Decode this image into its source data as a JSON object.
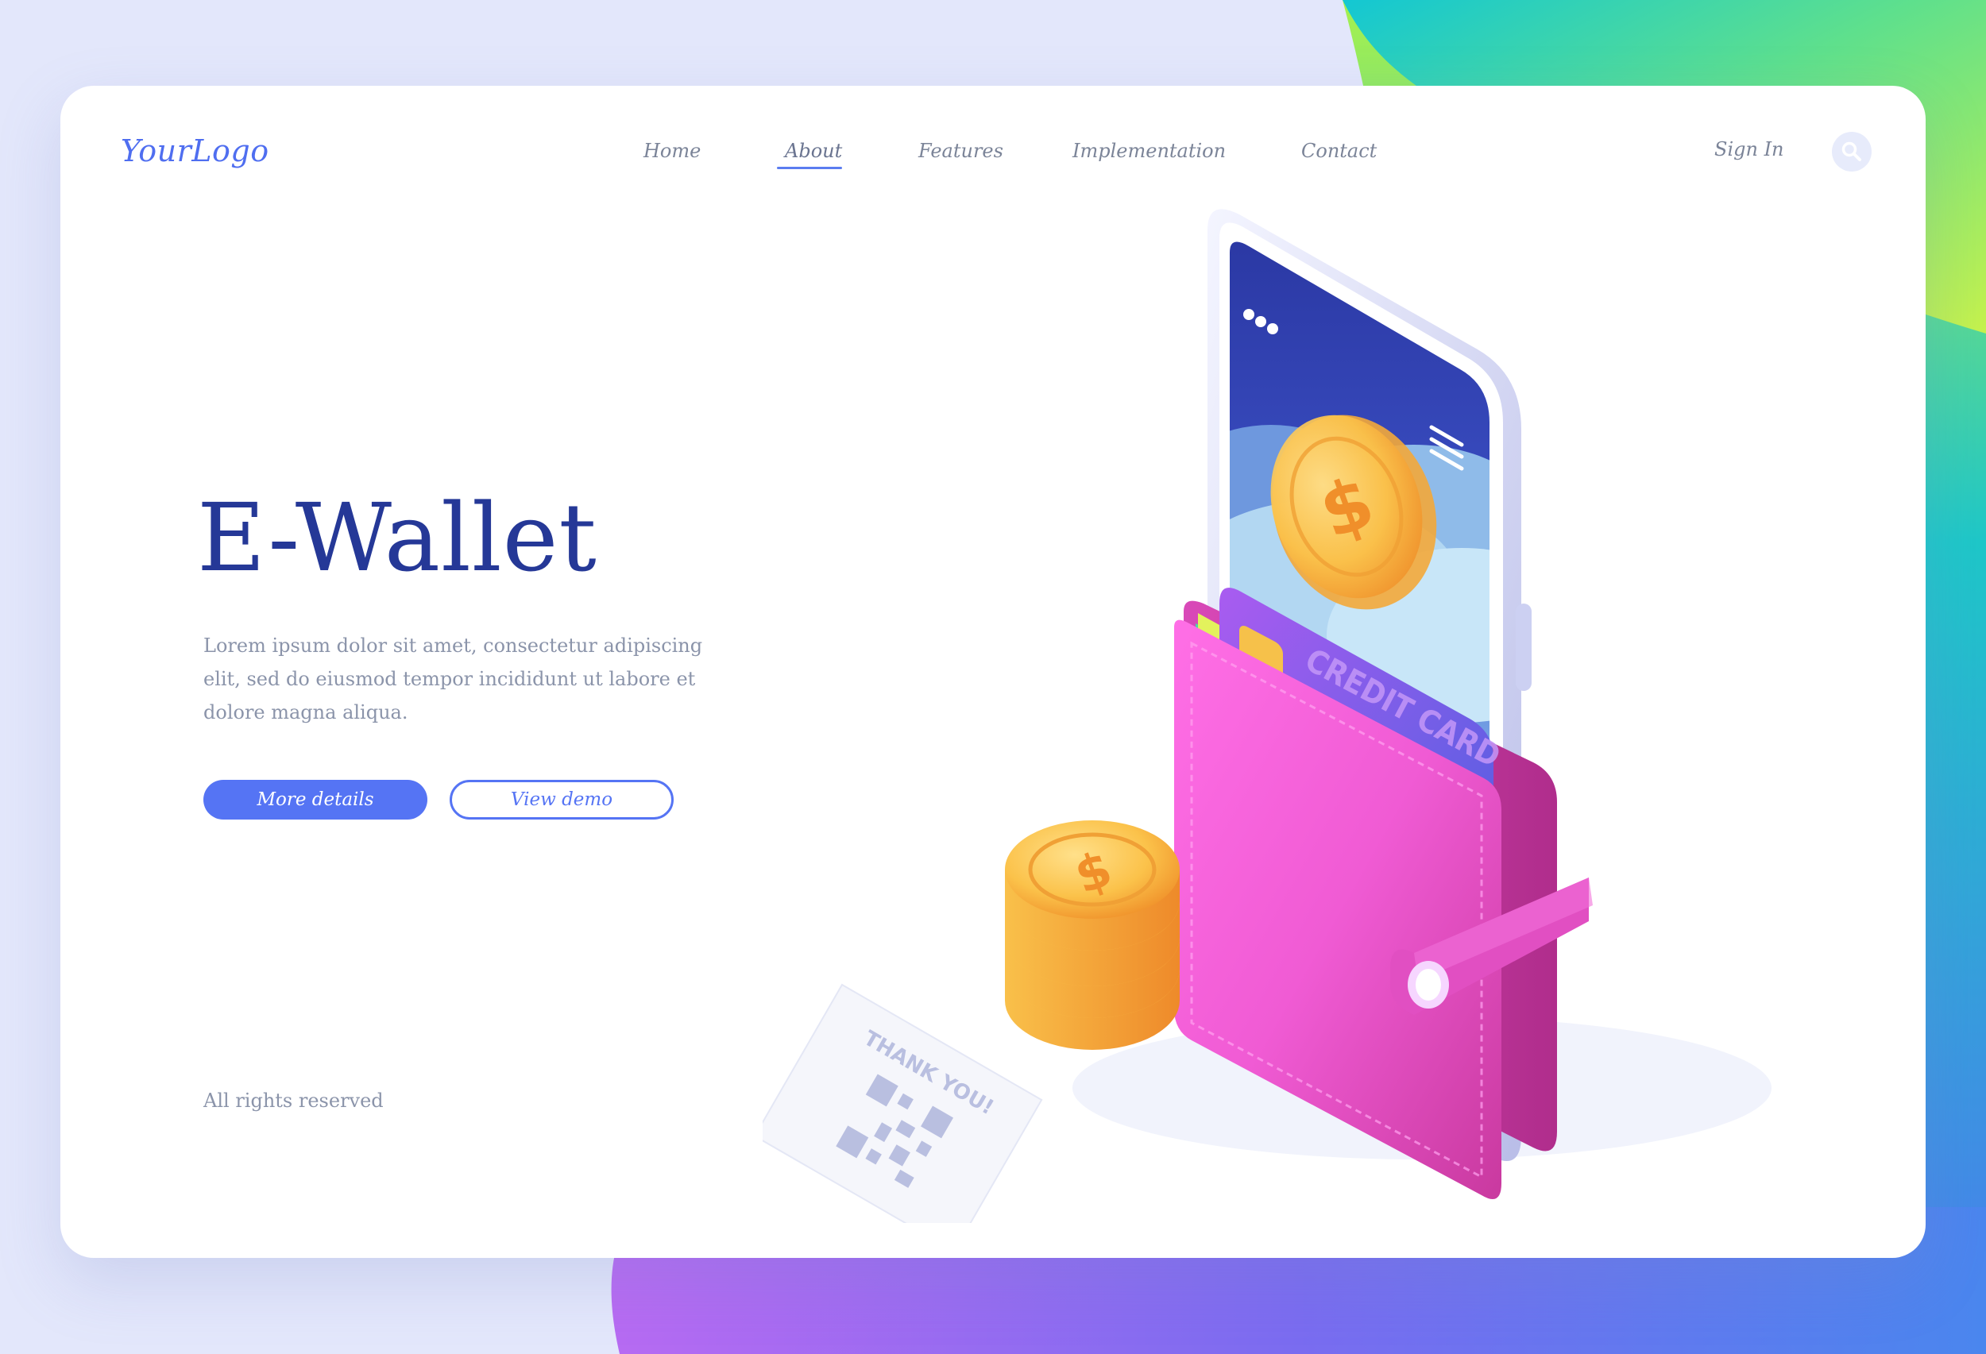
{
  "brand": {
    "logo": "YourLogo"
  },
  "nav": {
    "items": [
      {
        "label": "Home",
        "active": false
      },
      {
        "label": "About",
        "active": true
      },
      {
        "label": "Features",
        "active": false
      },
      {
        "label": "Implementation",
        "active": false
      },
      {
        "label": "Contact",
        "active": false
      }
    ],
    "sign_in": "Sign In",
    "search_icon": "search-icon"
  },
  "hero": {
    "title": "E-Wallet",
    "body": "Lorem ipsum dolor sit amet, consectetur adipiscing elit, sed do eiusmod tempor incididunt ut labore et dolore magna aliqua.",
    "primary_button": "More details",
    "secondary_button": "View demo"
  },
  "footer": {
    "text": "All rights reserved"
  },
  "illustration": {
    "card_label": "CREDIT CARD",
    "receipt_text": "THANK YOU!",
    "currency_symbol": "$"
  },
  "colors": {
    "accent": "#5574f4",
    "title": "#253897",
    "wallet": "#e952c4",
    "coin": "#f8b73c"
  }
}
